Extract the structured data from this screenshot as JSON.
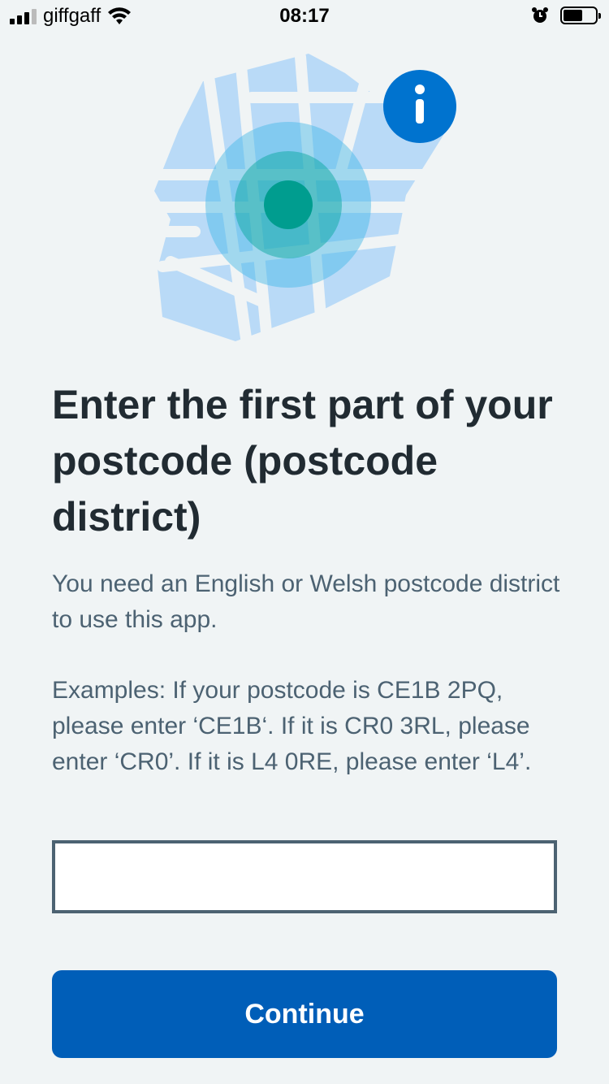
{
  "status_bar": {
    "carrier": "giffgaff",
    "time": "08:17",
    "icons": [
      "signal-icon",
      "wifi-icon",
      "alarm-icon",
      "battery-icon"
    ]
  },
  "illustration": {
    "icons": [
      "map-icon",
      "location-pin-icon",
      "info-icon"
    ],
    "colors": {
      "map": "#b9daf7",
      "location": "#009d8f",
      "info": "#0073cf"
    }
  },
  "content": {
    "title": "Enter the first part of your postcode (postcode district)",
    "intro": "You need an English or Welsh postcode district to use this app.",
    "examples": "Examples: If your postcode is CE1B 2PQ, please enter ‘CE1B‘. If it is CR0 3RL, please enter ‘CR0’. If it is L4 0RE, please enter ‘L4’."
  },
  "form": {
    "postcode_value": "",
    "continue_label": "Continue"
  },
  "colors": {
    "background": "#f0f4f5",
    "text_primary": "#212b32",
    "text_secondary": "#4c6272",
    "button": "#005eb8"
  }
}
